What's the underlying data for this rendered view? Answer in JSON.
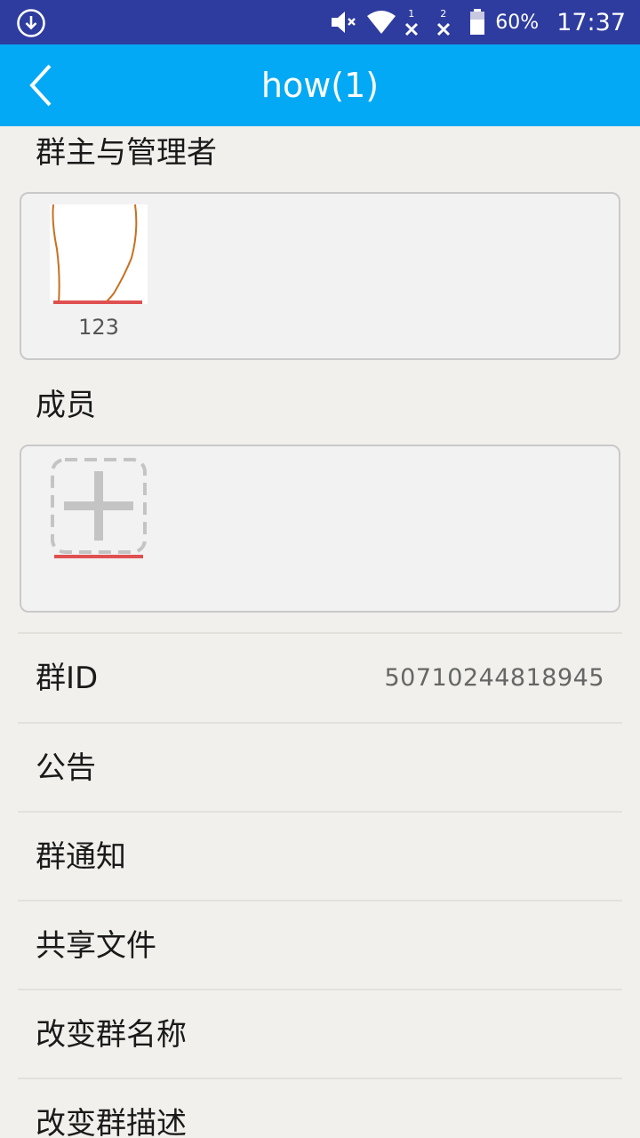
{
  "status_bar": {
    "download_icon": "download-circle-icon",
    "mute_icon": "volume-mute-icon",
    "wifi_icon": "wifi-icon",
    "sim1_icon": "no-signal-sim1-icon",
    "sim1_label": "1",
    "sim2_icon": "no-signal-sim2-icon",
    "sim2_label": "2",
    "battery_icon": "battery-icon",
    "battery_percent": "60%",
    "time": "17:37"
  },
  "app_bar": {
    "back_icon": "chevron-left-icon",
    "title": "how(1)",
    "color": "#03a9f4"
  },
  "owners_section": {
    "label": "群主与管理者",
    "members": [
      {
        "name": "123"
      }
    ]
  },
  "members_section": {
    "label": "成员",
    "add_icon": "plus-icon"
  },
  "rows": [
    {
      "label": "群ID",
      "value": "50710244818945"
    },
    {
      "label": "公告"
    },
    {
      "label": "群通知"
    },
    {
      "label": "共享文件"
    },
    {
      "label": "改变群名称"
    },
    {
      "label": "改变群描述"
    }
  ]
}
